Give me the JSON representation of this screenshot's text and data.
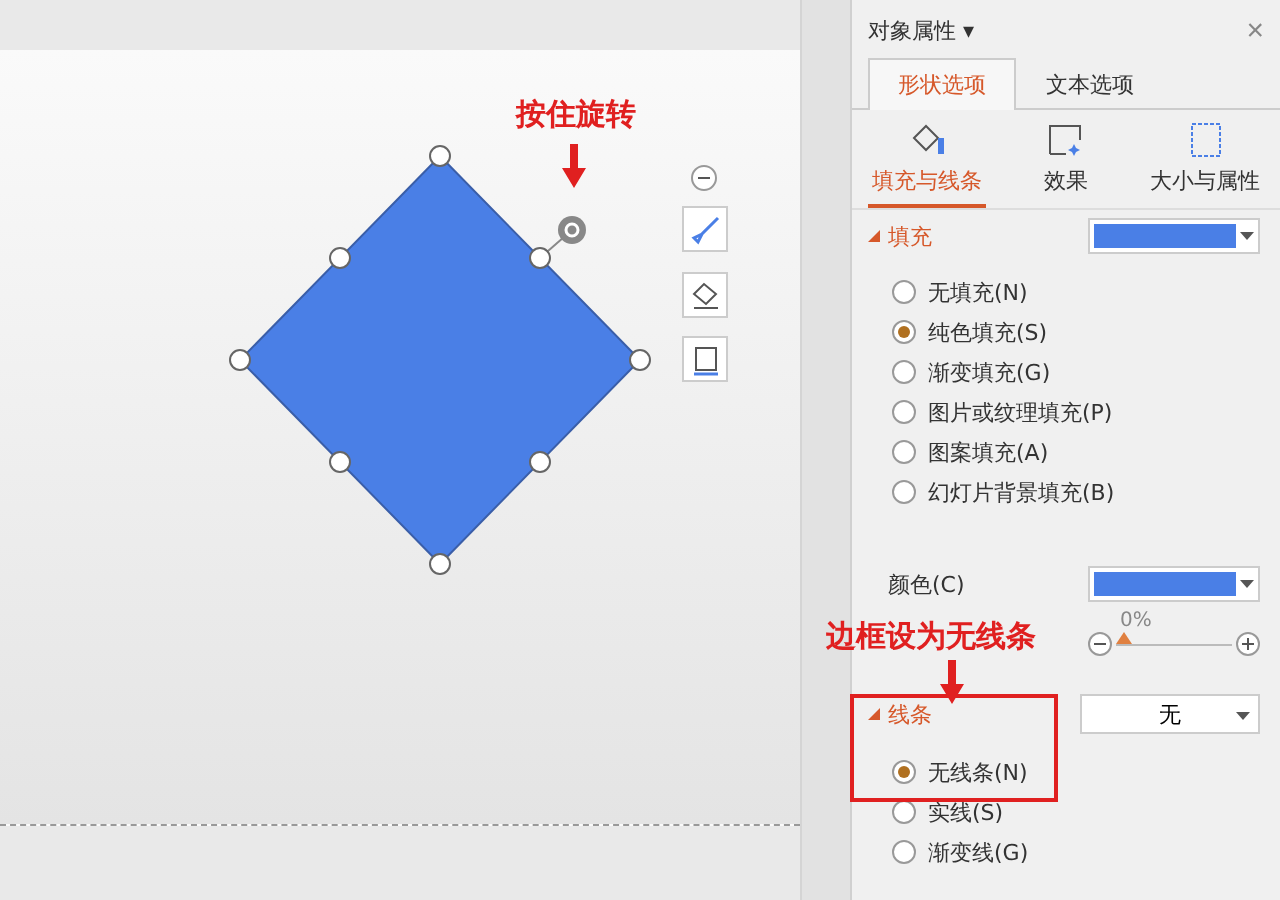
{
  "panel": {
    "title": "对象属性",
    "menu_mark": "▾",
    "close": "×",
    "tabs": [
      {
        "label": "形状选项",
        "selected": true
      },
      {
        "label": "文本选项",
        "selected": false
      }
    ],
    "subtabs": [
      {
        "kind": "fill",
        "label": "填充与线条",
        "selected": true
      },
      {
        "kind": "effect",
        "label": "效果",
        "selected": false
      },
      {
        "kind": "size",
        "label": "大小与属性",
        "selected": false
      }
    ],
    "fill": {
      "title": "填充",
      "expanded": true,
      "options": [
        {
          "label": "无填充(N)",
          "selected": false
        },
        {
          "label": "纯色填充(S)",
          "selected": true
        },
        {
          "label": "渐变填充(G)",
          "selected": false
        },
        {
          "label": "图片或纹理填充(P)",
          "selected": false
        },
        {
          "label": "图案填充(A)",
          "selected": false
        },
        {
          "label": "幻灯片背景填充(B)",
          "selected": false
        }
      ],
      "color_label": "颜色(C)",
      "transparency": {
        "reading": "0%",
        "level": 0
      }
    },
    "line": {
      "title": "线条",
      "expanded": true,
      "value": "无",
      "options": [
        {
          "label": "无线条(N)",
          "selected": true
        },
        {
          "label": "实线(S)",
          "selected": false
        },
        {
          "label": "渐变线(G)",
          "selected": false
        }
      ]
    }
  },
  "annotations": [
    {
      "kind": "rotate",
      "text": "按住旋转"
    },
    {
      "kind": "border",
      "text": "边框设为无线条"
    }
  ]
}
